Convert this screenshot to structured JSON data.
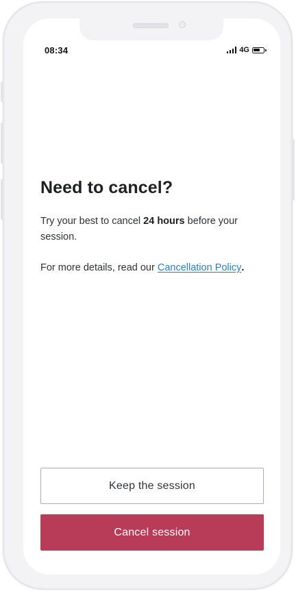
{
  "status_bar": {
    "time": "08:34",
    "network": "4G"
  },
  "dialog": {
    "title": "Need to cancel?",
    "line1_prefix": "Try your best to cancel ",
    "line1_bold": "24 hours",
    "line1_suffix": " before your session.",
    "line2_prefix": "For more details, read our ",
    "policy_link": "Cancellation Policy",
    "line2_suffix": "."
  },
  "actions": {
    "keep_label": "Keep the session",
    "cancel_label": "Cancel session"
  },
  "colors": {
    "primary_action": "#b83c58",
    "link": "#2a7fc0"
  }
}
